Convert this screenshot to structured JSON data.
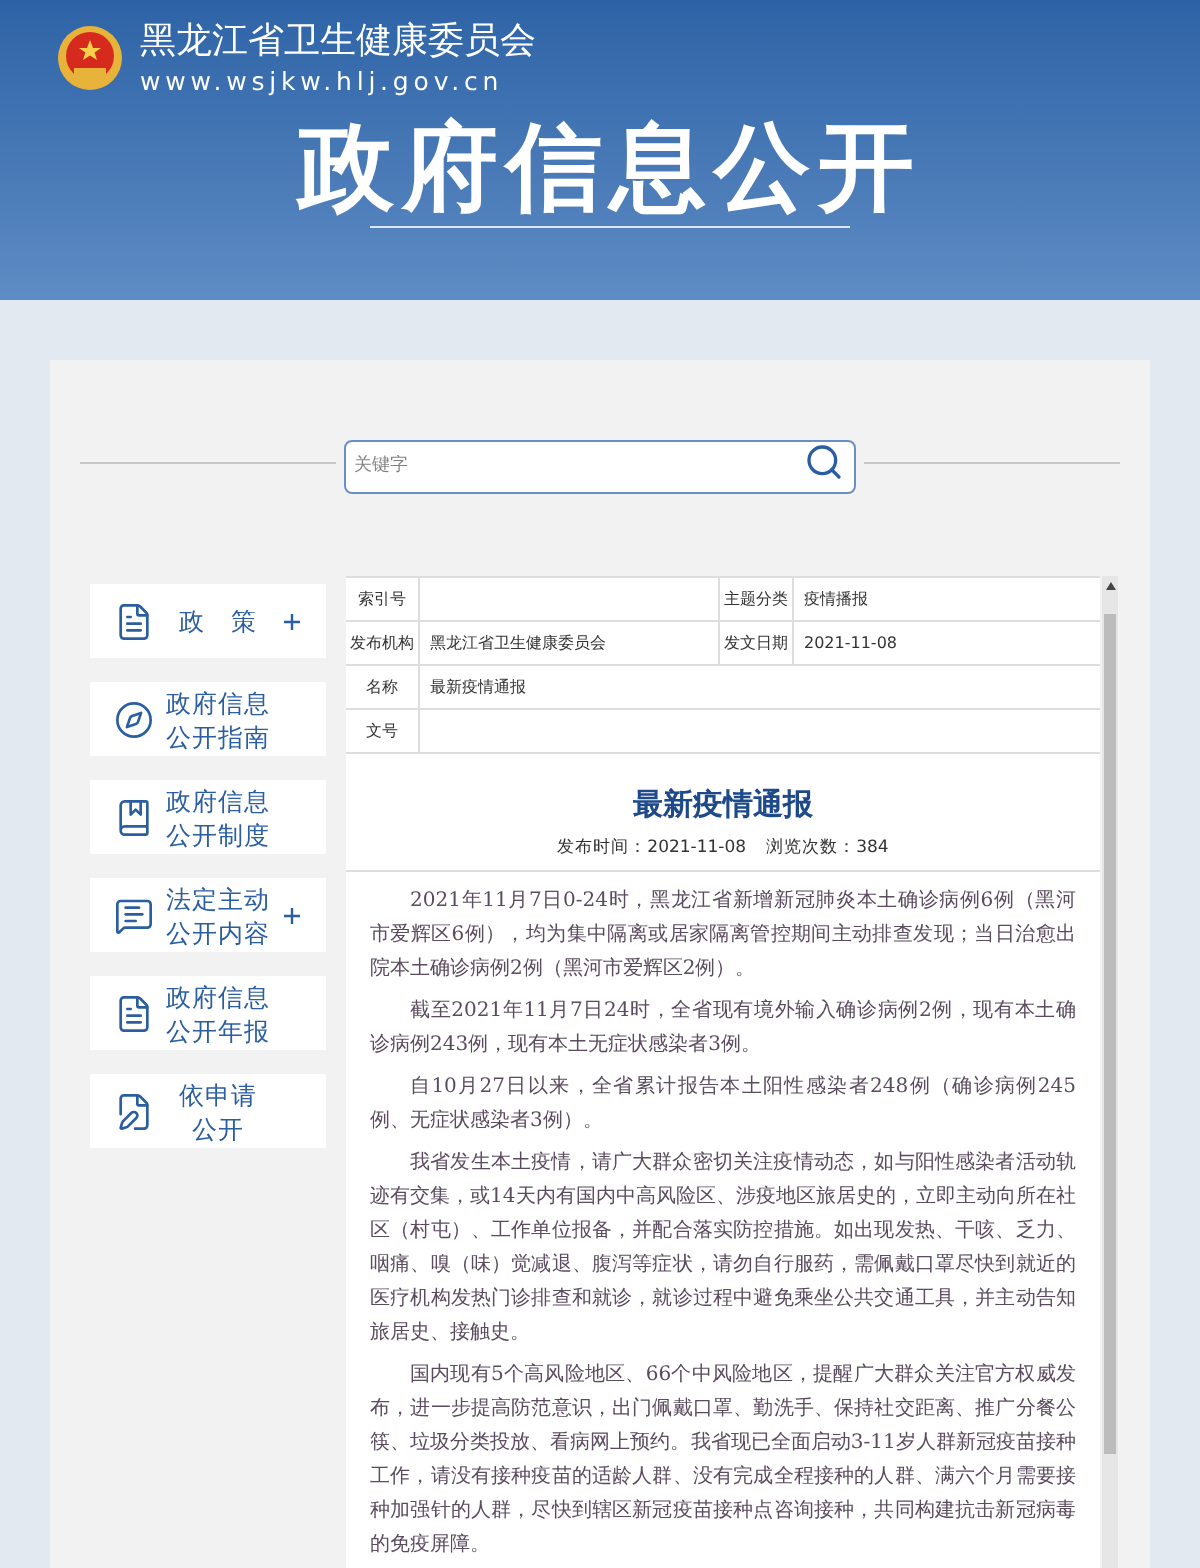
{
  "header": {
    "org_name": "黑龙江省卫生健康委员会",
    "url": "www.wsjkw.hlj.gov.cn",
    "banner_title": "政府信息公开"
  },
  "search": {
    "placeholder": "关键字"
  },
  "sidebar": {
    "items": [
      {
        "kind": "document",
        "lines": [
          "政　策"
        ],
        "expandable": true
      },
      {
        "kind": "compass",
        "lines": [
          "政府信息",
          "公开指南"
        ],
        "expandable": false
      },
      {
        "kind": "book",
        "lines": [
          "政府信息",
          "公开制度"
        ],
        "expandable": false
      },
      {
        "kind": "chat",
        "lines": [
          "法定主动",
          "公开内容"
        ],
        "expandable": true
      },
      {
        "kind": "document",
        "lines": [
          "政府信息",
          "公开年报"
        ],
        "expandable": false
      },
      {
        "kind": "edit",
        "lines": [
          "依申请",
          "公开"
        ],
        "expandable": false
      }
    ]
  },
  "meta_table": {
    "rows": [
      {
        "cells": [
          {
            "label": "索引号"
          },
          {
            "label": "主题分类",
            "value": "疫情播报"
          }
        ]
      },
      {
        "cells": [
          {
            "label": "发布机构",
            "value": "黑龙江省卫生健康委员会"
          },
          {
            "label": "发文日期",
            "value": "2021-11-08"
          }
        ]
      },
      {
        "cells": [
          {
            "label": "名称",
            "value": "最新疫情通报"
          }
        ]
      },
      {
        "cells": [
          {
            "label": "文号"
          }
        ]
      }
    ]
  },
  "article": {
    "title": "最新疫情通报",
    "published": "发布时间：2021-11-08",
    "views": "浏览次数：384",
    "paragraphs": [
      "2021年11月7日0-24时，黑龙江省新增新冠肺炎本土确诊病例6例（黑河市爱辉区6例），均为集中隔离或居家隔离管控期间主动排查发现；当日治愈出院本土确诊病例2例（黑河市爱辉区2例）。",
      "截至2021年11月7日24时，全省现有境外输入确诊病例2例，现有本土确诊病例243例，现有本土无症状感染者3例。",
      "自10月27日以来，全省累计报告本土阳性感染者248例（确诊病例245例、无症状感染者3例）。",
      "我省发生本土疫情，请广大群众密切关注疫情动态，如与阳性感染者活动轨迹有交集，或14天内有国内中高风险区、涉疫地区旅居史的，立即主动向所在社区（村屯）、工作单位报备，并配合落实防控措施。如出现发热、干咳、乏力、咽痛、嗅（味）觉减退、腹泻等症状，请勿自行服药，需佩戴口罩尽快到就近的医疗机构发热门诊排查和就诊，就诊过程中避免乘坐公共交通工具，并主动告知旅居史、接触史。",
      "国内现有5个高风险地区、66个中风险地区，提醒广大群众关注官方权威发布，进一步提高防范意识，出门佩戴口罩、勤洗手、保持社交距离、推广分餐公筷、垃圾分类投放、看病网上预约。我省现已全面启动3-11岁人群新冠疫苗接种工作，请没有接种疫苗的适龄人群、没有完成全程接种的人群、满六个月需要接种加强针的人群，尽快到辖区新冠疫苗接种点咨询接种，共同构建抗击新冠病毒的免疫屏障。"
    ]
  }
}
